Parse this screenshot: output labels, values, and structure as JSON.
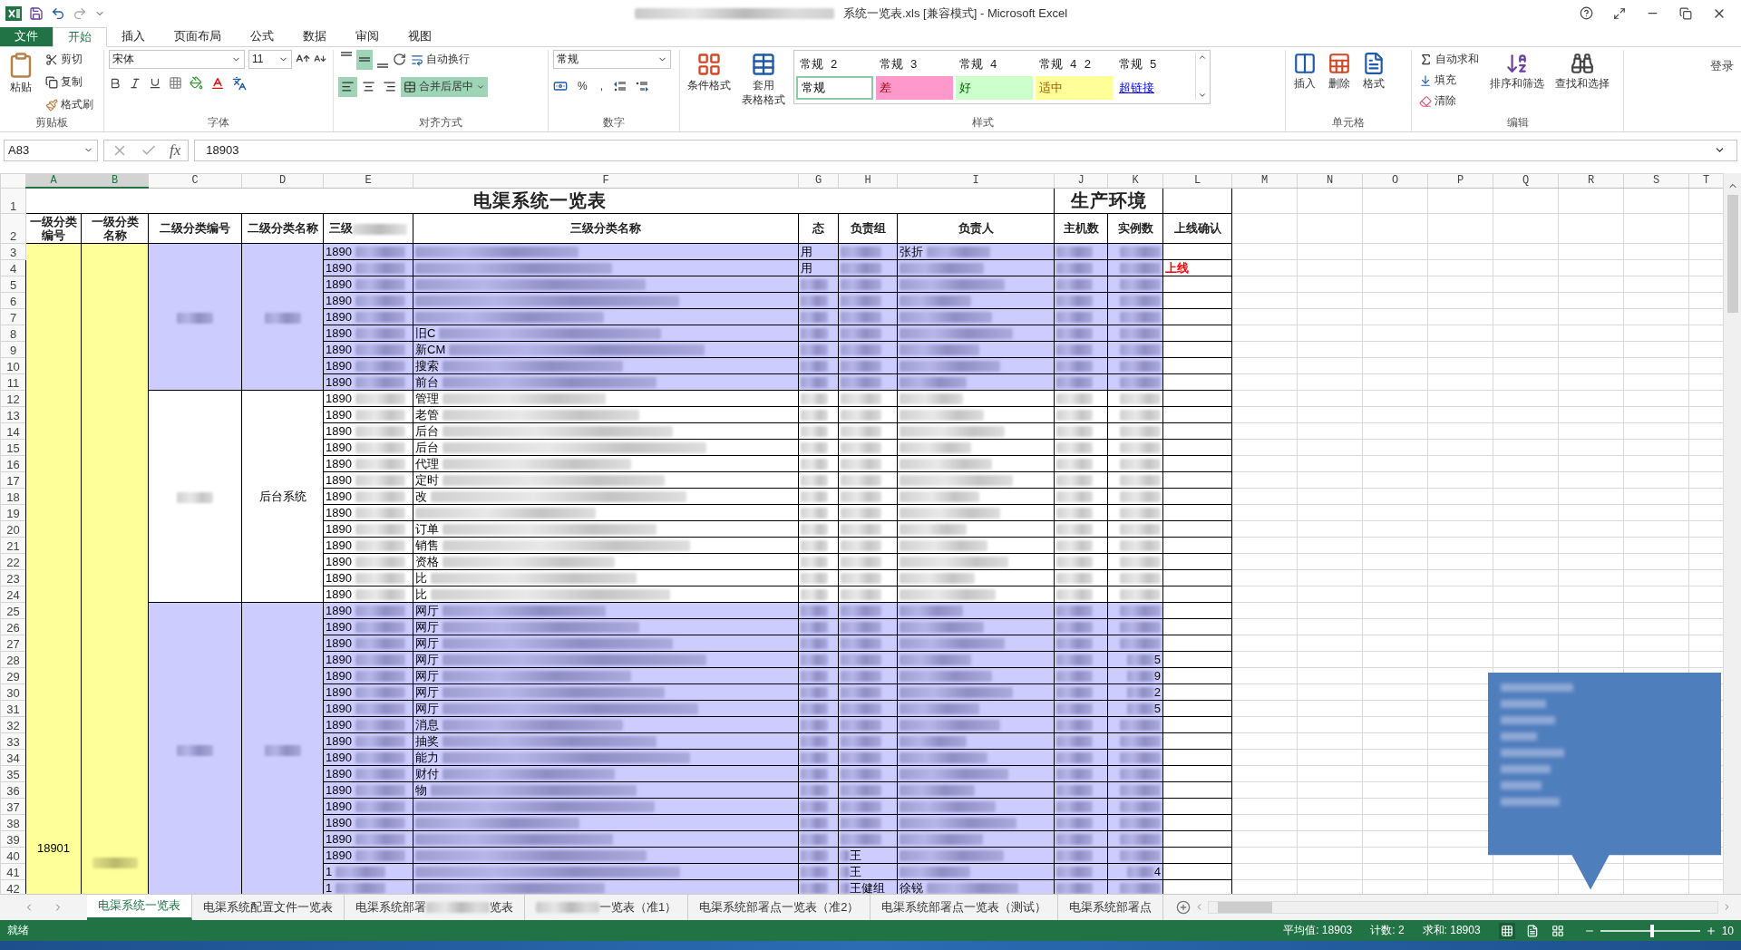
{
  "title_bar": {
    "title": "系统一览表.xls  [兼容模式] - Microsoft Excel",
    "sign_in": "登录"
  },
  "ribbon_tabs": [
    {
      "label": "文件",
      "kind": "file",
      "selected": false
    },
    {
      "label": "开始",
      "kind": "tab",
      "selected": true
    },
    {
      "label": "插入",
      "kind": "tab",
      "selected": false
    },
    {
      "label": "页面布局",
      "kind": "tab",
      "selected": false
    },
    {
      "label": "公式",
      "kind": "tab",
      "selected": false
    },
    {
      "label": "数据",
      "kind": "tab",
      "selected": false
    },
    {
      "label": "审阅",
      "kind": "tab",
      "selected": false
    },
    {
      "label": "视图",
      "kind": "tab",
      "selected": false
    }
  ],
  "ribbon": {
    "clipboard": {
      "label": "剪贴板",
      "paste": "粘贴",
      "cut": "剪切",
      "copy": "复制",
      "painter": "格式刷"
    },
    "font": {
      "label": "字体",
      "name": "宋体",
      "size": "11"
    },
    "alignment": {
      "label": "对齐方式",
      "wrap": "自动换行",
      "merge": "合并后居中",
      "merge_on": true,
      "valign": [
        {
          "selected": false
        },
        {
          "selected": true
        },
        {
          "selected": false
        }
      ],
      "halign": [
        {
          "selected": true
        },
        {
          "selected": false
        },
        {
          "selected": false
        }
      ]
    },
    "number": {
      "label": "数字",
      "format": "常规",
      "percent": "%",
      "comma": ","
    },
    "styles": {
      "label": "样式",
      "conditional": "条件格式",
      "table_a": "套用",
      "table_b": "表格格式",
      "names": [
        "常规 2",
        "常规 3",
        "常规 4",
        "常规 4 2",
        "常规 5"
      ],
      "swatches": [
        {
          "label": "常规",
          "kind": "normal",
          "selected": true
        },
        {
          "label": "差",
          "kind": "bad",
          "selected": false
        },
        {
          "label": "好",
          "kind": "good",
          "selected": false
        },
        {
          "label": "适中",
          "kind": "neutral",
          "selected": false
        },
        {
          "label": "超链接",
          "kind": "link",
          "selected": false
        }
      ]
    },
    "cells": {
      "label": "单元格",
      "insert": "插入",
      "delete": "删除",
      "format": "格式"
    },
    "editing": {
      "label": "编辑",
      "autosum": "自动求和",
      "fill": "填充",
      "clear": "清除",
      "sort": "排序和筛选",
      "find": "查找和选择"
    }
  },
  "formula_bar": {
    "name_box": "A83",
    "fx": "fx",
    "value": "18903"
  },
  "sheet": {
    "columns": [
      {
        "label": "A",
        "selected": true
      },
      {
        "label": "B",
        "selected": true
      },
      {
        "label": "C",
        "selected": false
      },
      {
        "label": "D",
        "selected": false
      },
      {
        "label": "E",
        "selected": false
      },
      {
        "label": "F",
        "selected": false
      },
      {
        "label": "G",
        "selected": false
      },
      {
        "label": "H",
        "selected": false
      },
      {
        "label": "I",
        "selected": false
      },
      {
        "label": "J",
        "selected": false
      },
      {
        "label": "K",
        "selected": false
      },
      {
        "label": "L",
        "selected": false
      },
      {
        "label": "M",
        "selected": false
      },
      {
        "label": "N",
        "selected": false
      },
      {
        "label": "O",
        "selected": false
      },
      {
        "label": "P",
        "selected": false
      },
      {
        "label": "Q",
        "selected": false
      },
      {
        "label": "R",
        "selected": false
      },
      {
        "label": "S",
        "selected": false
      },
      {
        "label": "T",
        "selected": false
      }
    ],
    "title_row": {
      "num": "1",
      "title": "电渠系统一览表",
      "env": "生产环境"
    },
    "header_row": {
      "num": "2",
      "cells": [
        "一级分类编号",
        "一级分类名称",
        "二级分类编号",
        "二级分类名称",
        "三级",
        "三级分类名称",
        "态",
        "负责组",
        "负责人",
        "主机数",
        "实例数",
        "上线确认"
      ]
    },
    "a_value": "18901",
    "sections": [
      {
        "shaded": true,
        "rows": [
          {
            "num": "3",
            "e": "1890",
            "g": "用",
            "i": "张折"
          },
          {
            "num": "4",
            "e": "1890",
            "g": "用",
            "l": "上线"
          },
          {
            "num": "5",
            "e": "1890"
          },
          {
            "num": "6",
            "e": "1890"
          },
          {
            "num": "7",
            "e": "1890"
          },
          {
            "num": "8",
            "e": "1890",
            "f": "旧C"
          },
          {
            "num": "9",
            "e": "1890",
            "f": "新CM"
          },
          {
            "num": "10",
            "e": "1890",
            "f": "搜索"
          },
          {
            "num": "11",
            "e": "1890",
            "f": "前台"
          }
        ]
      },
      {
        "shaded": false,
        "d_label": "后台系统",
        "rows": [
          {
            "num": "12",
            "e": "1890",
            "f": "管理"
          },
          {
            "num": "13",
            "e": "1890",
            "f": "老管"
          },
          {
            "num": "14",
            "e": "1890",
            "f": "后台"
          },
          {
            "num": "15",
            "e": "1890",
            "f": "后台"
          },
          {
            "num": "16",
            "e": "1890",
            "f": "代理"
          },
          {
            "num": "17",
            "e": "1890",
            "f": "定时"
          },
          {
            "num": "18",
            "e": "1890",
            "f": "改"
          },
          {
            "num": "19",
            "e": "1890"
          },
          {
            "num": "20",
            "e": "1890",
            "f": "订单"
          },
          {
            "num": "21",
            "e": "1890",
            "f": "销售"
          },
          {
            "num": "22",
            "e": "1890",
            "f": "资格"
          },
          {
            "num": "23",
            "e": "1890",
            "f": "比"
          },
          {
            "num": "24",
            "e": "1890",
            "f": "比"
          }
        ]
      },
      {
        "shaded": true,
        "rows": [
          {
            "num": "25",
            "e": "1890",
            "f": "网厅"
          },
          {
            "num": "26",
            "e": "1890",
            "f": "网厅"
          },
          {
            "num": "27",
            "e": "1890",
            "f": "网厅"
          },
          {
            "num": "28",
            "e": "1890",
            "f": "网厅",
            "k": "5"
          },
          {
            "num": "29",
            "e": "1890",
            "f": "网厅",
            "k": "9"
          },
          {
            "num": "30",
            "e": "1890",
            "f": "网厅",
            "k": "2"
          },
          {
            "num": "31",
            "e": "1890",
            "f": "网厅",
            "k": "5"
          },
          {
            "num": "32",
            "e": "1890",
            "f": "消息"
          },
          {
            "num": "33",
            "e": "1890",
            "f": "抽奖"
          },
          {
            "num": "34",
            "e": "1890",
            "f": "能力"
          },
          {
            "num": "35",
            "e": "1890",
            "f": "财付"
          },
          {
            "num": "36",
            "e": "1890",
            "f": "物"
          },
          {
            "num": "37",
            "e": "1890"
          },
          {
            "num": "38",
            "e": "1890"
          },
          {
            "num": "39",
            "e": "1890"
          },
          {
            "num": "40",
            "e": "1890",
            "h": "王"
          },
          {
            "num": "41",
            "e": "1",
            "h": "王",
            "k": "4"
          },
          {
            "num": "42",
            "e": "1",
            "h": "王健组",
            "i": "徐锐"
          }
        ]
      }
    ]
  },
  "sheet_tabs": [
    {
      "prefix": "电渠系统一览表",
      "kind": "plain",
      "selected": true
    },
    {
      "prefix": "电渠系统配置文件一览表",
      "kind": "plain",
      "selected": false
    },
    {
      "prefix": "电渠系统部署",
      "suffix": "览表",
      "kind": "blurred",
      "selected": false
    },
    {
      "suffix": "一览表（准1）",
      "kind": "blurred",
      "selected": false
    },
    {
      "prefix": "电渠系统部署点一览表（准2）",
      "kind": "plain",
      "selected": false
    },
    {
      "prefix": "电渠系统部署点一览表（测试）",
      "kind": "plain",
      "selected": false
    },
    {
      "prefix": "电渠系统部署点",
      "kind": "plain",
      "selected": false
    }
  ],
  "status_bar": {
    "ready": "就绪",
    "average": "平均值: 18903",
    "count": "计数: 2",
    "sum": "求和: 18903",
    "zoom": "10",
    "view": [
      {
        "selected": true
      },
      {
        "selected": false
      },
      {
        "selected": false
      }
    ],
    "level": 0.5
  }
}
